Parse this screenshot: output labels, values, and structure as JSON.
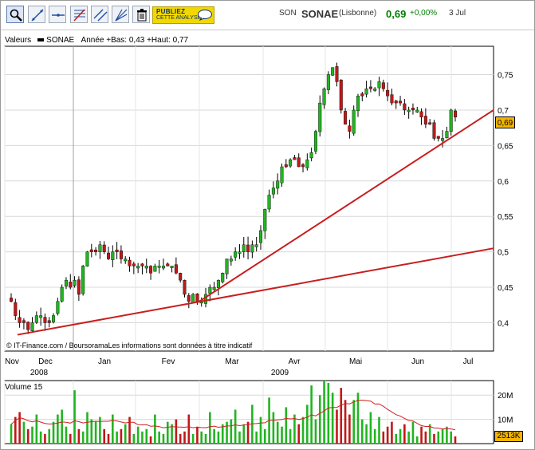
{
  "toolbar": {
    "tools": [
      {
        "name": "zoom-tool",
        "icon": "magnifier-icon"
      },
      {
        "name": "trendline-tool",
        "icon": "trendline-icon"
      },
      {
        "name": "horizontal-line-tool",
        "icon": "horizontal-line-icon"
      },
      {
        "name": "indicator-tool",
        "icon": "indicator-icon"
      },
      {
        "name": "parallel-line-tool",
        "icon": "parallel-lines-icon"
      },
      {
        "name": "fan-tool",
        "icon": "fan-icon"
      },
      {
        "name": "delete-tool",
        "icon": "trash-icon"
      }
    ],
    "promo_line1": "PUBLIEZ",
    "promo_line2": "CETTE ANALYSE"
  },
  "quote": {
    "prefix": "SON",
    "name": "SONAE",
    "market": "(Lisbonne)",
    "price": "0,69",
    "change": "+0,00%",
    "date": "3 Jul",
    "up_color": "#007f00"
  },
  "legend": {
    "label": "Valeurs",
    "series": "SONAE",
    "info": "Année +Bas: 0,43 +Haut: 0,77"
  },
  "price_tag": "0,69",
  "copyright": "© IT-Finance.com / BoursoramaLes informations sont données à titre indicatif",
  "volume": {
    "label": "Volume 15",
    "axis_ticks": [
      "20M",
      "10M"
    ],
    "current": "2513K"
  },
  "chart_data": {
    "type": "candlestick",
    "title": "",
    "xlabel": "",
    "ylabel": "",
    "ylim": [
      0.36,
      0.79
    ],
    "y_ticks": [
      0.4,
      0.45,
      0.5,
      0.55,
      0.6,
      0.65,
      0.7,
      0.75
    ],
    "y_tick_labels": [
      "0,4",
      "0,45",
      "0,5",
      "0,55",
      "0,6",
      "0,65",
      "0,7",
      "0,75"
    ],
    "x_tick_labels": [
      "Nov",
      "Dec",
      "Jan",
      "Fev",
      "Mar",
      "Avr",
      "Mai",
      "Jun",
      "Jul"
    ],
    "year_labels": [
      "2008",
      "2009"
    ],
    "grid": true,
    "colors": {
      "up": "#22b422",
      "down": "#c01818",
      "trend": "#c81e1e",
      "volume_ma": "#d02020"
    },
    "close_series": [
      0.43,
      0.41,
      0.4,
      0.4,
      0.39,
      0.4,
      0.41,
      0.41,
      0.4,
      0.4,
      0.41,
      0.43,
      0.45,
      0.46,
      0.45,
      0.46,
      0.44,
      0.48,
      0.5,
      0.5,
      0.5,
      0.51,
      0.5,
      0.49,
      0.5,
      0.5,
      0.49,
      0.49,
      0.48,
      0.48,
      0.48,
      0.48,
      0.48,
      0.47,
      0.48,
      0.48,
      0.48,
      0.48,
      0.48,
      0.47,
      0.46,
      0.44,
      0.43,
      0.44,
      0.43,
      0.43,
      0.44,
      0.45,
      0.45,
      0.46,
      0.47,
      0.49,
      0.49,
      0.5,
      0.5,
      0.51,
      0.5,
      0.51,
      0.51,
      0.53,
      0.56,
      0.58,
      0.59,
      0.6,
      0.62,
      0.62,
      0.63,
      0.63,
      0.62,
      0.62,
      0.63,
      0.64,
      0.67,
      0.71,
      0.73,
      0.75,
      0.76,
      0.74,
      0.7,
      0.68,
      0.67,
      0.7,
      0.72,
      0.72,
      0.73,
      0.73,
      0.73,
      0.74,
      0.73,
      0.72,
      0.71,
      0.71,
      0.71,
      0.7,
      0.7,
      0.7,
      0.7,
      0.69,
      0.68,
      0.68,
      0.66,
      0.66,
      0.66,
      0.67,
      0.7,
      0.69
    ],
    "trendlines": [
      {
        "from": [
          "Nov",
          0.383
        ],
        "to": [
          "Jul",
          0.505
        ]
      },
      {
        "from": [
          "Fev",
          0.43
        ],
        "to": [
          "Jul",
          0.7
        ]
      }
    ],
    "volume_series_m": [
      8,
      11,
      13,
      9,
      6,
      7,
      12,
      5,
      4,
      6,
      9,
      12,
      14,
      7,
      4,
      22,
      6,
      5,
      13,
      10,
      9,
      11,
      6,
      4,
      12,
      5,
      6,
      8,
      11,
      4,
      7,
      5,
      6,
      3,
      12,
      5,
      4,
      9,
      8,
      10,
      4,
      5,
      12,
      4,
      7,
      5,
      4,
      13,
      6,
      5,
      8,
      9,
      10,
      14,
      5,
      8,
      9,
      16,
      5,
      11,
      6,
      19,
      13,
      9,
      7,
      15,
      6,
      12,
      8,
      11,
      16,
      24,
      10,
      20,
      26,
      25,
      21,
      14,
      23,
      18,
      12,
      18,
      21,
      10,
      8,
      13,
      6,
      11,
      5,
      7,
      9,
      4,
      6,
      8,
      5,
      9,
      3,
      7,
      5,
      8,
      4,
      5,
      6,
      7,
      5,
      3
    ],
    "volume_ylim": [
      0,
      26
    ]
  }
}
